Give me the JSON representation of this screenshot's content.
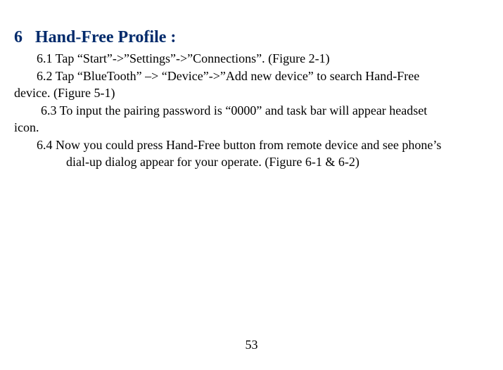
{
  "heading": {
    "number": "6",
    "title": "Hand-Free Profile :"
  },
  "items": {
    "p1": "6.1 Tap “Start”->”Settings”->”Connections”. (Figure 2-1)",
    "p2a": "6.2 Tap “BlueTooth” –> “Device”->”Add new device” to search Hand-Free",
    "p2b": "device. (Figure 5-1)",
    "p3a": "6.3 To input the pairing password is “0000” and task bar will appear headset",
    "p3b": "icon.",
    "p4a": "6.4 Now you could press Hand-Free button from remote device and see phone’s",
    "p4b": "dial-up dialog appear for your operate. (Figure 6-1 & 6-2)"
  },
  "pageNumber": "53"
}
